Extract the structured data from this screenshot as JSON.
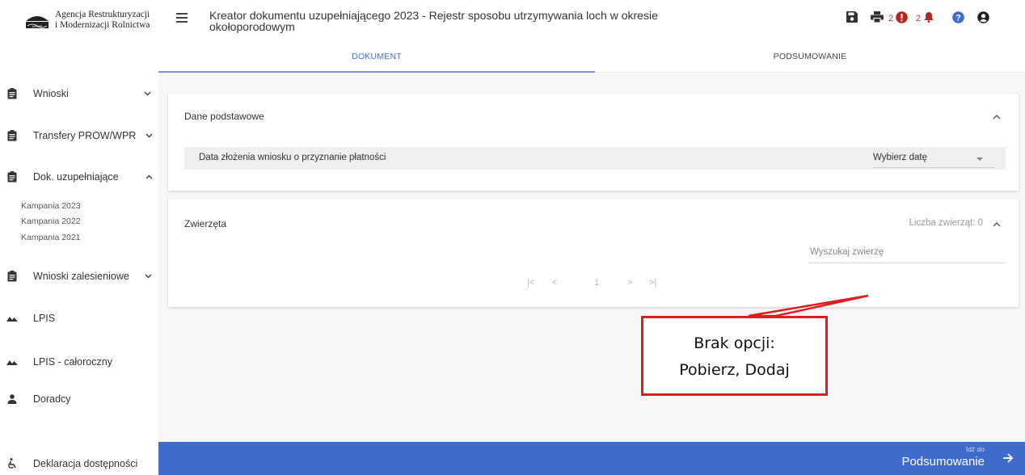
{
  "sidebar": {
    "logo": {
      "line1": "Agencja Restrukturyzacji",
      "line2": "i Modernizacji Rolnictwa",
      "mark_text": "ARiMR"
    },
    "items": [
      {
        "label": "Wnioski",
        "icon": "clipboard-icon",
        "chevron": "down"
      },
      {
        "label": "Transfery PROW/WPR",
        "icon": "clipboard-icon",
        "chevron": "down"
      },
      {
        "label": "Dok. uzupełniające",
        "icon": "clipboard-icon",
        "chevron": "up"
      },
      {
        "label": "Wnioski zalesieniowe",
        "icon": "clipboard-icon",
        "chevron": "down"
      },
      {
        "label": "LPIS",
        "icon": "mountains-icon"
      },
      {
        "label": "LPIS - całoroczny",
        "icon": "mountains-icon"
      },
      {
        "label": "Doradcy",
        "icon": "person-icon"
      },
      {
        "label": "Deklaracja dostępności",
        "icon": "accessibility-icon"
      }
    ],
    "subitems": [
      "Kampania 2023",
      "Kampania 2022",
      "Kampania 2021"
    ]
  },
  "header": {
    "title": "Kreator dokumentu uzupełniającego 2023 - Rejestr sposobu utrzymywania loch w okresie okołoporodowym",
    "errors_count": "2",
    "notifications_count": "2",
    "icons": [
      "save-icon",
      "print-icon",
      "error-icon",
      "bell-icon",
      "help-icon",
      "account-icon"
    ]
  },
  "tabs": {
    "document": "DOKUMENT",
    "summary": "PODSUMOWANIE"
  },
  "basic": {
    "title": "Dane podstawowe",
    "date_label": "Data złożenia wniosku o przyznanie płatności",
    "date_value": "Wybierz datę"
  },
  "animals": {
    "title": "Zwierzęta",
    "count_label": "Liczba zwierząt: 0",
    "search_placeholder": "Wyszukaj zwierzę",
    "pager": {
      "first": "|<",
      "prev": "<",
      "page": "1",
      "next": ">",
      "last": ">|"
    }
  },
  "callout": {
    "line1": "Brak opcji:",
    "line2": "Pobierz, Dodaj"
  },
  "footer": {
    "small": "Idź do",
    "big": "Podsumowanie"
  },
  "colors": {
    "accent": "#3f6ccc",
    "tab_active": "#3f6fd1",
    "error": "#c0392b",
    "callout_border": "#e21c1c"
  }
}
